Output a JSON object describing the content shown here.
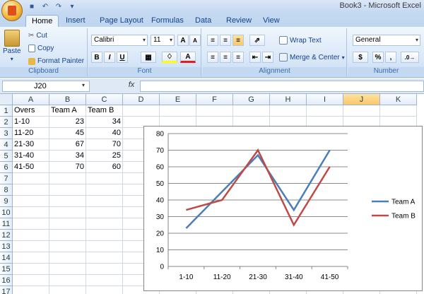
{
  "window": {
    "title": "Book3 - Microsoft Excel"
  },
  "ribbon": {
    "tabs": [
      "Home",
      "Insert",
      "Page Layout",
      "Formulas",
      "Data",
      "Review",
      "View"
    ],
    "clipboard": {
      "label": "Clipboard",
      "paste": "Paste",
      "cut": "Cut",
      "copy": "Copy",
      "format_painter": "Format Painter"
    },
    "font": {
      "label": "Font",
      "family": "Calibri",
      "size": "11",
      "bold": "B",
      "italic": "I",
      "underline": "U"
    },
    "alignment": {
      "label": "Alignment",
      "wrap_text": "Wrap Text",
      "merge_center": "Merge & Center"
    },
    "number": {
      "label": "Number",
      "format": "General",
      "currency": "$",
      "percent": "%",
      "comma": ","
    }
  },
  "formula_bar": {
    "name_box": "J20",
    "fx": "fx",
    "value": ""
  },
  "sheet": {
    "columns": [
      "A",
      "B",
      "C",
      "D",
      "E",
      "F",
      "G",
      "H",
      "I",
      "J",
      "K"
    ],
    "selected_column": "J",
    "rows": [
      "1",
      "2",
      "3",
      "4",
      "5",
      "6",
      "7",
      "8",
      "9",
      "10",
      "11",
      "12",
      "13",
      "14",
      "15",
      "16",
      "17"
    ],
    "headers": [
      "Overs",
      "Team A",
      "Team B"
    ],
    "data": [
      [
        "1-10",
        "23",
        "34"
      ],
      [
        "11-20",
        "45",
        "40"
      ],
      [
        "21-30",
        "67",
        "70"
      ],
      [
        "31-40",
        "34",
        "25"
      ],
      [
        "41-50",
        "70",
        "60"
      ]
    ]
  },
  "chart_data": {
    "type": "line",
    "categories": [
      "1-10",
      "11-20",
      "21-30",
      "31-40",
      "41-50"
    ],
    "series": [
      {
        "name": "Team A",
        "values": [
          23,
          45,
          67,
          34,
          70
        ],
        "color": "#4a7ebb"
      },
      {
        "name": "Team B",
        "values": [
          34,
          40,
          70,
          25,
          60
        ],
        "color": "#be4b48"
      }
    ],
    "title": "",
    "xlabel": "",
    "ylabel": "",
    "ylim": [
      0,
      80
    ],
    "yticks": [
      0,
      10,
      20,
      30,
      40,
      50,
      60,
      70,
      80
    ],
    "grid": true,
    "legend": "right"
  }
}
